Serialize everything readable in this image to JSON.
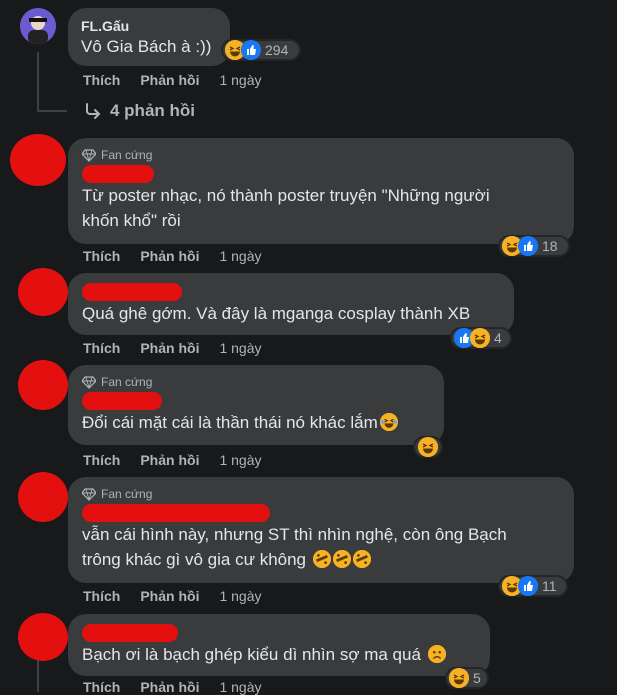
{
  "colors": {
    "background": "#18191a",
    "bubble": "#3a3b3c",
    "text": "#e4e6eb",
    "muted": "#b0b3b8",
    "redaction": "#e4100f",
    "like": "#1877f2",
    "haha": "#f7b125"
  },
  "labels": {
    "like": "Thích",
    "reply": "Phản hồi",
    "fan_badge": "Fan cứng"
  },
  "comments": [
    {
      "author": "FL.Gấu",
      "text": "Vô Gia Bách à :))",
      "time": "1 ngày",
      "reactions": [
        "haha-icon",
        "like-icon"
      ],
      "reaction_count": "294",
      "replies_label": "4 phản hồi"
    },
    {
      "author": "",
      "badge": true,
      "text": "Từ poster nhạc, nó thành poster truyện \"Những người\nkhốn khổ\" rồi",
      "time": "1 ngày",
      "reactions": [
        "haha-icon",
        "like-icon"
      ],
      "reaction_count": "18"
    },
    {
      "author": "",
      "badge": false,
      "text": "Quá ghê gớm. Và đây là mganga cosplay thành XB",
      "time": "1 ngày",
      "reactions": [
        "like-icon",
        "haha-icon"
      ],
      "reaction_count": "4"
    },
    {
      "author": "",
      "badge": true,
      "text": "Đổi cái mặt cái là thần thái nó khác lắm",
      "inline_emojis": [
        "crying-laugh-emoji"
      ],
      "time": "1 ngày",
      "reactions": [
        "haha-icon"
      ],
      "reaction_count": ""
    },
    {
      "author": "",
      "badge": true,
      "text": "vẫn cái hình này, nhưng ST thì nhìn nghệ, còn ông Bạch\ntrông khác gì vô gia cư không",
      "inline_emojis": [
        "rofl-emoji",
        "rofl-emoji",
        "rofl-emoji"
      ],
      "time": "1 ngày",
      "reactions": [
        "haha-icon",
        "like-icon"
      ],
      "reaction_count": "11"
    },
    {
      "author": "",
      "badge": false,
      "text": "Bạch ơi là bạch ghép kiểu dì nhìn sợ ma quá",
      "inline_emojis": [
        "worried-emoji"
      ],
      "time": "1 ngày",
      "reactions": [
        "haha-icon"
      ],
      "reaction_count": "5"
    }
  ]
}
